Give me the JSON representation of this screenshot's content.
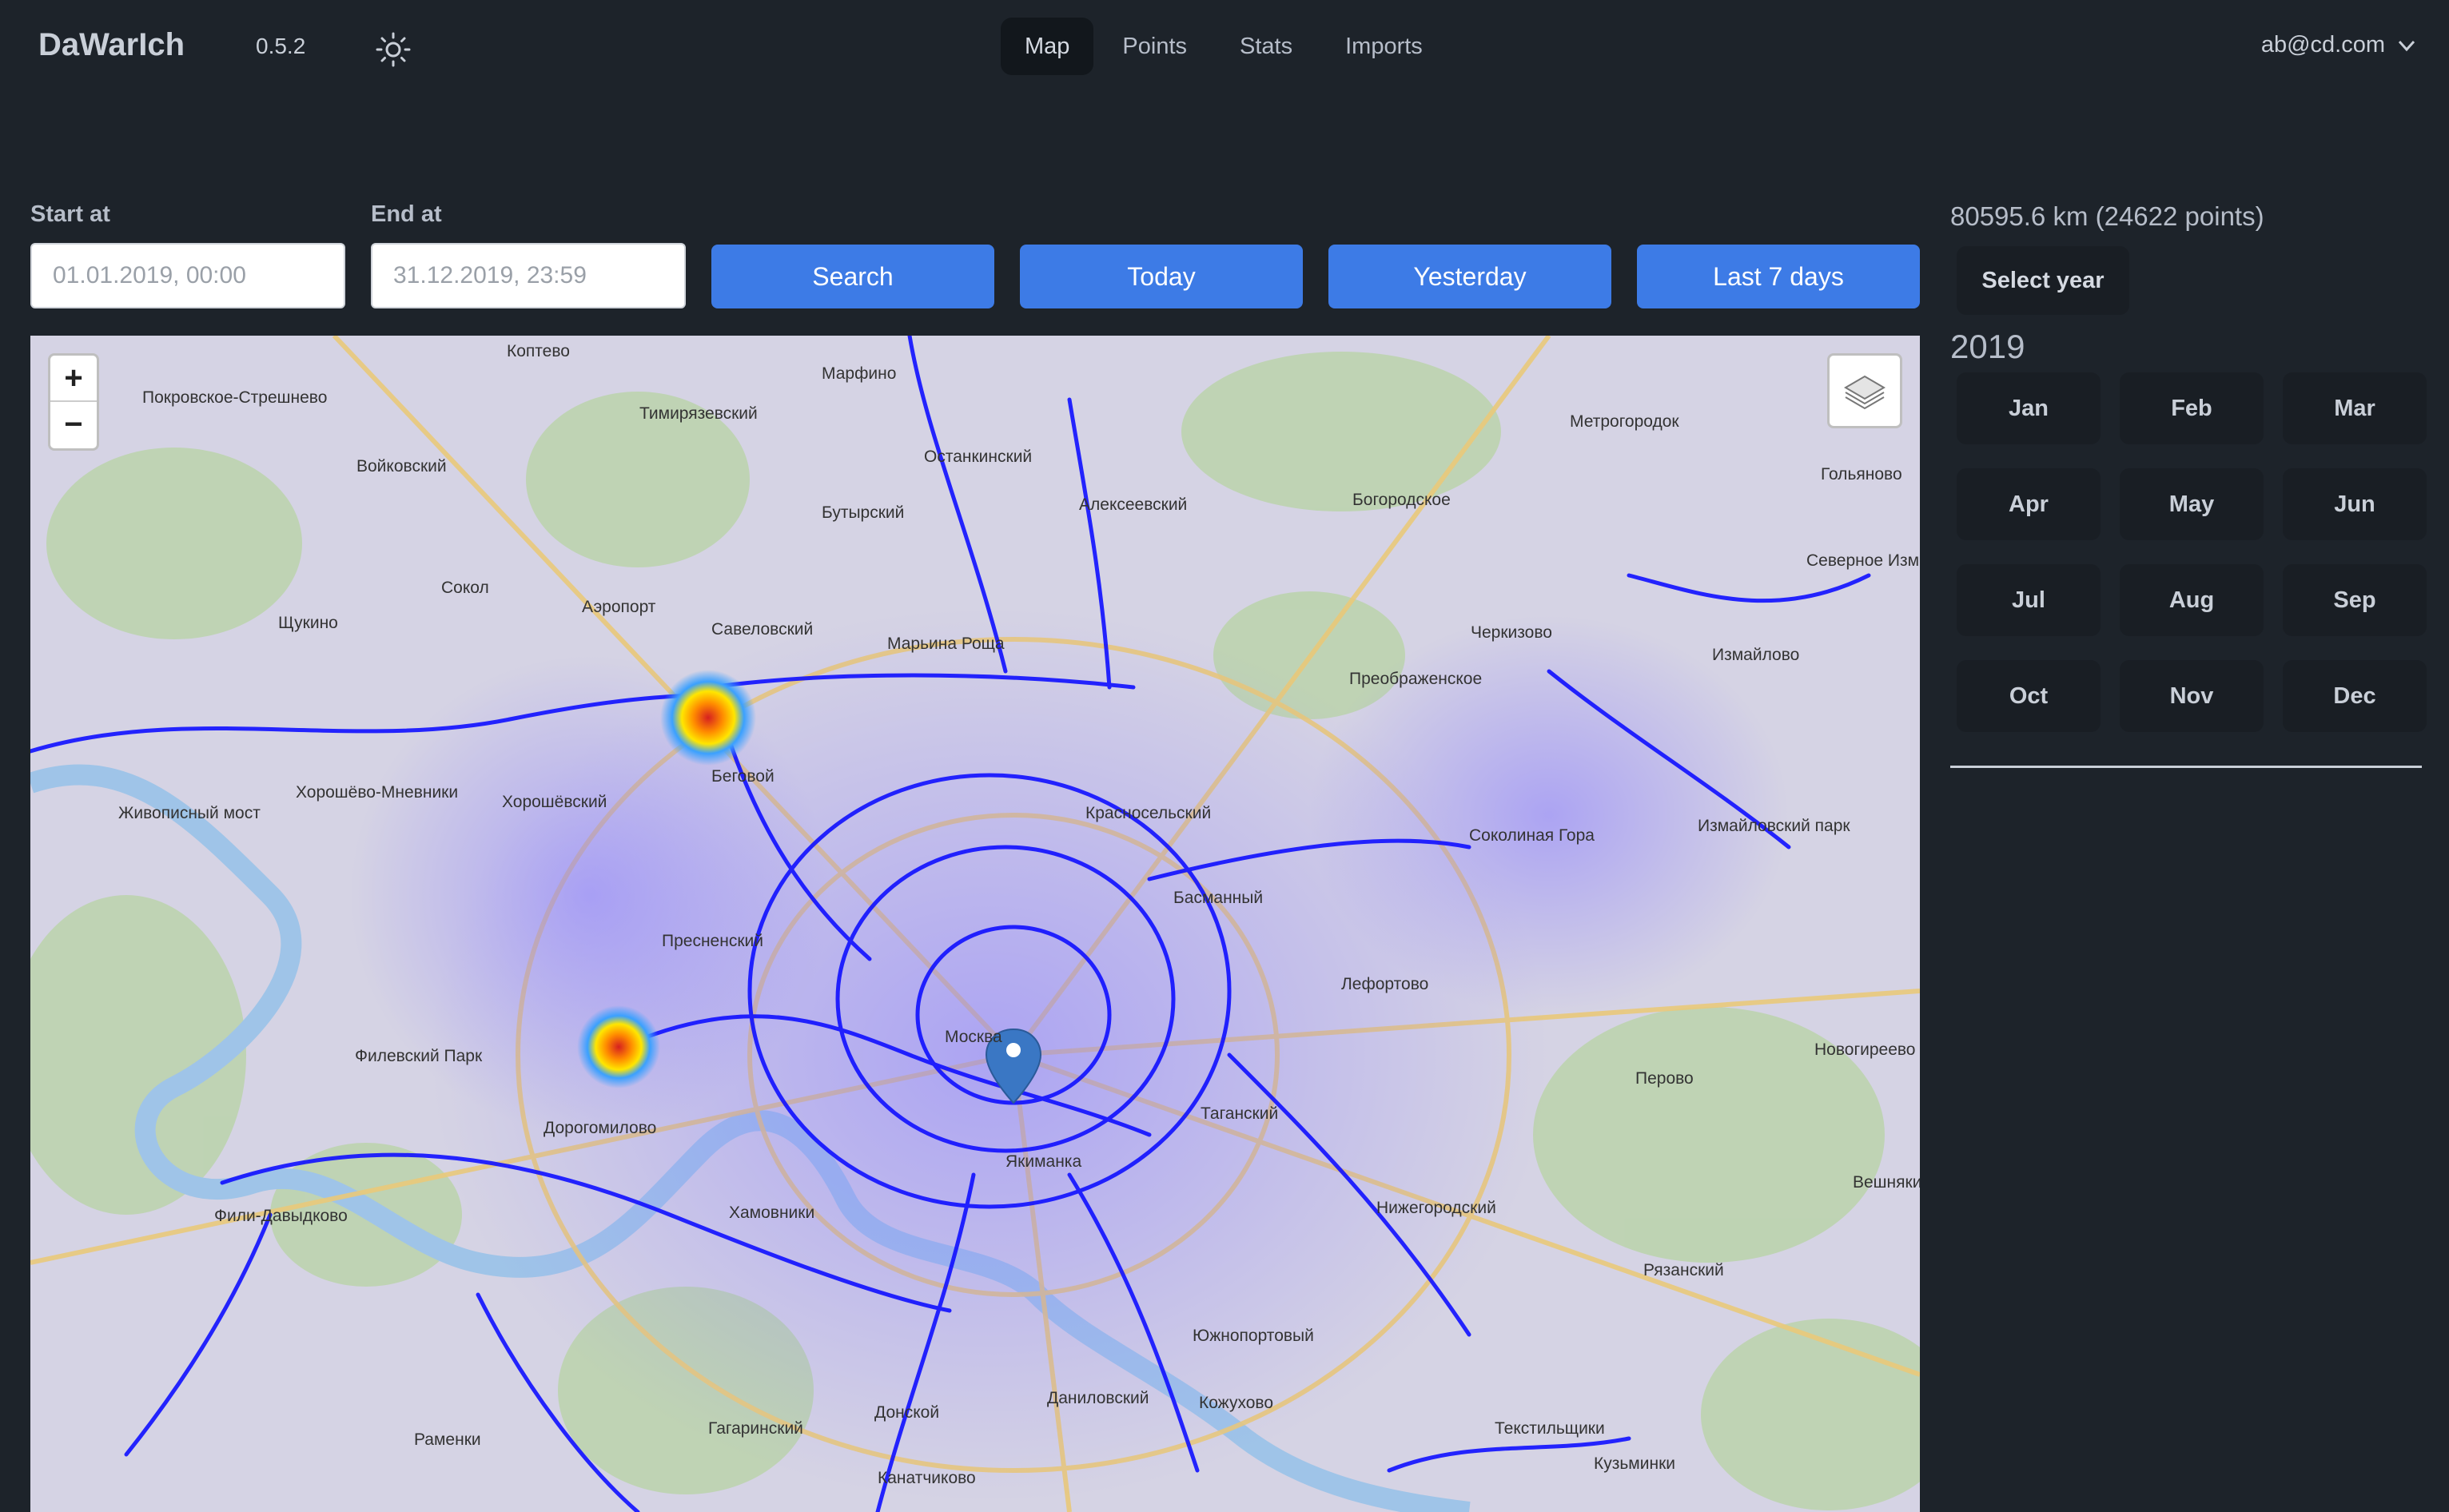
{
  "navbar": {
    "brand": "DaWarIch",
    "version": "0.5.2",
    "links": [
      "Map",
      "Points",
      "Stats",
      "Imports"
    ],
    "active_link": "Map",
    "user_email": "ab@cd.com"
  },
  "filters": {
    "start_label": "Start at",
    "start_value": "01.01.2019, 00:00",
    "end_label": "End at",
    "end_value": "31.12.2019, 23:59",
    "buttons": [
      "Search",
      "Today",
      "Yesterday",
      "Last 7 days"
    ]
  },
  "map": {
    "zoom_in": "+",
    "zoom_out": "−",
    "labels": [
      "Покровское-Стрешнево",
      "Коптево",
      "Тимирязевский",
      "Марфино",
      "Метрогородок",
      "Гольяново",
      "Войковский",
      "Останкинский",
      "Бутырский",
      "Алексеевский",
      "Богородское",
      "Сокол",
      "Аэропорт",
      "Савеловский",
      "Марьина Роща",
      "Черкизово",
      "Северное Измайлово",
      "Щукино",
      "Преображенское",
      "Измайлово",
      "Хорошёво-Мневники",
      "Хорошёвский",
      "Беговой",
      "Красносельский",
      "Живописный мост",
      "Соколиная Гора",
      "Измайловский парк",
      "Пресненский",
      "Басманный",
      "Лефортово",
      "Филевский Парк",
      "Москва",
      "Перово",
      "Новогиреево",
      "Дорогомилово",
      "Таганский",
      "Фили-Давыдково",
      "Хамовники",
      "Якиманка",
      "Нижегородский",
      "Вешняки",
      "Рязанский",
      "Южнопортовый",
      "Даниловский",
      "Кожухово",
      "Донской",
      "Гагаринский",
      "Раменки",
      "Текстильщики",
      "Кузьминки",
      "Канатчиково"
    ]
  },
  "sidebar": {
    "stats": "80595.6 km (24622 points)",
    "select_year": "Select year",
    "year": "2019",
    "months": [
      "Jan",
      "Feb",
      "Mar",
      "Apr",
      "May",
      "Jun",
      "Jul",
      "Aug",
      "Sep",
      "Oct",
      "Nov",
      "Dec"
    ]
  },
  "icons": {
    "theme": "sun-icon",
    "user_menu": "chevron-down-icon",
    "layers": "layers-icon",
    "marker": "map-pin-icon"
  },
  "colors": {
    "background": "#1d232a",
    "primary": "#3d7be6",
    "track": "#1010ff"
  }
}
